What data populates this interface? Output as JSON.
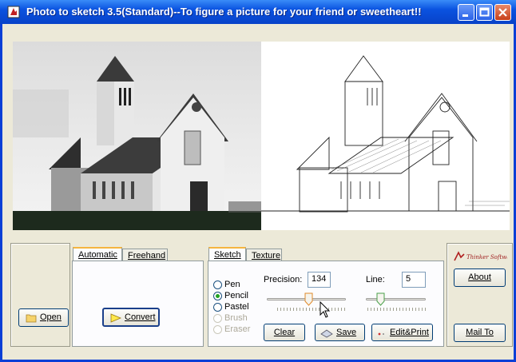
{
  "window": {
    "title": "Photo to sketch 3.5(Standard)--To figure a picture for your friend or sweetheart!!"
  },
  "brand": {
    "logo_text": "Thinker Software"
  },
  "colors": {
    "titlebar": "#0a52e0",
    "accent_tab": "#f5b540",
    "radio_dot": "#21a121"
  },
  "buttons": {
    "open": "Open",
    "convert": "Convert",
    "clear": "Clear",
    "save": "Save",
    "edit_print": "Edit&Print",
    "about": "About",
    "mail_to": "Mail To"
  },
  "mode_tabs": [
    {
      "label": "Automatic",
      "active": true
    },
    {
      "label": "Freehand",
      "active": false
    }
  ],
  "style_tabs": [
    {
      "label": "Sketch",
      "active": true
    },
    {
      "label": "Texture",
      "active": false
    }
  ],
  "tools": [
    {
      "label": "Pen",
      "selected": false,
      "enabled": true
    },
    {
      "label": "Pencil",
      "selected": true,
      "enabled": true
    },
    {
      "label": "Pastel",
      "selected": false,
      "enabled": true
    },
    {
      "label": "Brush",
      "selected": false,
      "enabled": false
    },
    {
      "label": "Eraser",
      "selected": false,
      "enabled": false
    }
  ],
  "precision": {
    "label": "Precision:",
    "value": "134",
    "slider_fraction": 0.53
  },
  "line": {
    "label": "Line:",
    "value": "5",
    "slider_fraction": 0.2
  },
  "icons": {
    "open": "folder-icon",
    "convert": "play-arrow-icon",
    "save": "save-icon",
    "edit_print": "print-icon",
    "app": "app-icon"
  }
}
